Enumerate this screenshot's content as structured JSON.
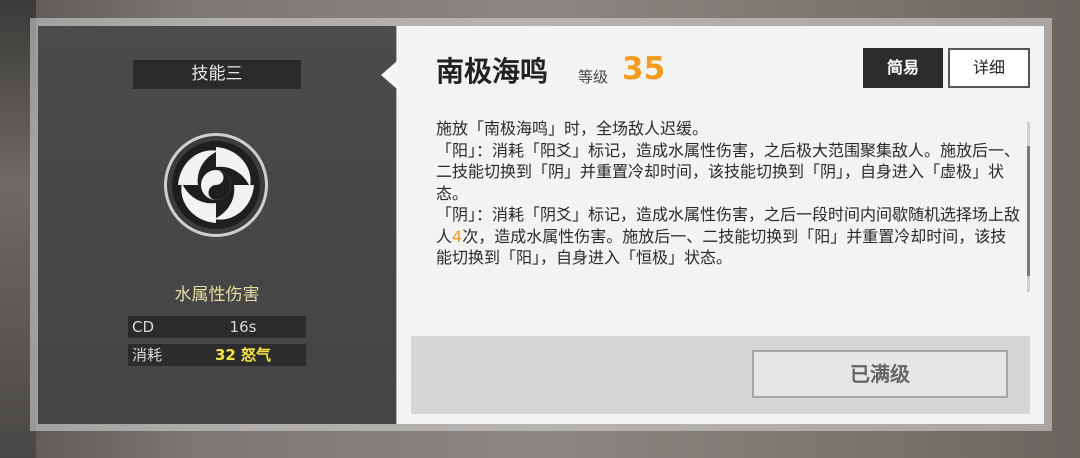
{
  "left_card": {
    "skill_slot": "技能三",
    "skill_icon": "yin-yang-swirl-icon",
    "damage_type": "水属性伤害",
    "stats": [
      {
        "label": "CD",
        "value": "16s"
      },
      {
        "label": "消耗",
        "value": "32 怒气"
      }
    ]
  },
  "skill": {
    "name": "南极海鸣",
    "level_label": "等级",
    "level_value": "35"
  },
  "toggle": {
    "simple_label": "简易",
    "detail_label": "详细"
  },
  "description": {
    "part1": "施放「南极海鸣」时，全场敌人迟缓。\n「阳」：消耗「阳爻」标记，造成水属性伤害，之后极大范围聚集敌人。施放后一、二技能切换到「阴」并重置冷却时间，该技能切换到「阴」，自身进入「虚极」状态。\n「阴」：消耗「阴爻」标记，造成水属性伤害，之后一段时间内间歇随机选择场上敌人",
    "highlight": "4",
    "part2": "次，造成水属性伤害。施放后一、二技能切换到「阳」并重置冷却时间，该技能切换到「阳」，自身进入「恒极」状态。"
  },
  "footer": {
    "maxed_label": "已满级"
  },
  "colors": {
    "level_accent": "#f39a1f",
    "cost_accent": "#f6e347",
    "damage_type_text": "#e3dca2"
  }
}
